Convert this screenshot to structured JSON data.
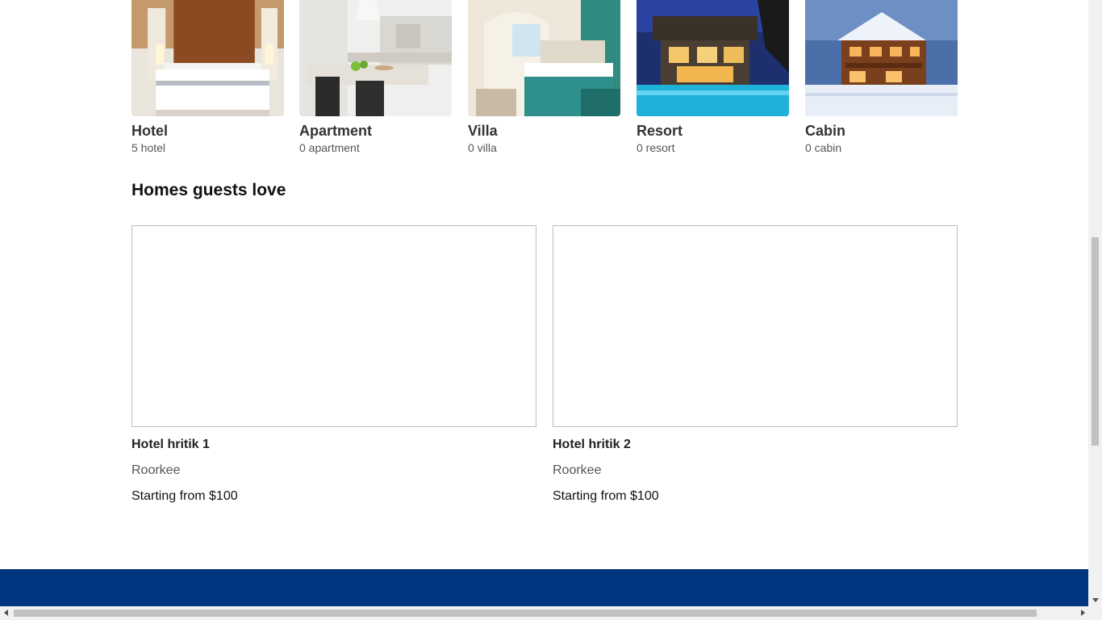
{
  "property_types": [
    {
      "title": "Hotel",
      "count": "5 hotel",
      "image": "hotel-room-photo"
    },
    {
      "title": "Apartment",
      "count": "0 apartment",
      "image": "apartment-kitchen-photo"
    },
    {
      "title": "Villa",
      "count": "0 villa",
      "image": "villa-bedroom-photo"
    },
    {
      "title": "Resort",
      "count": "0 resort",
      "image": "resort-pool-night-photo"
    },
    {
      "title": "Cabin",
      "count": "0 cabin",
      "image": "snow-cabin-photo"
    }
  ],
  "homes_section": {
    "heading": "Homes guests love",
    "items": [
      {
        "name": "Hotel hritik 1",
        "location": "Roorkee",
        "price": "Starting from $100"
      },
      {
        "name": "Hotel hritik 2",
        "location": "Roorkee",
        "price": "Starting from $100"
      }
    ]
  },
  "colors": {
    "footer": "#003580",
    "scrollbar_track": "#f1f1f1",
    "scrollbar_thumb": "#c1c1c1"
  }
}
